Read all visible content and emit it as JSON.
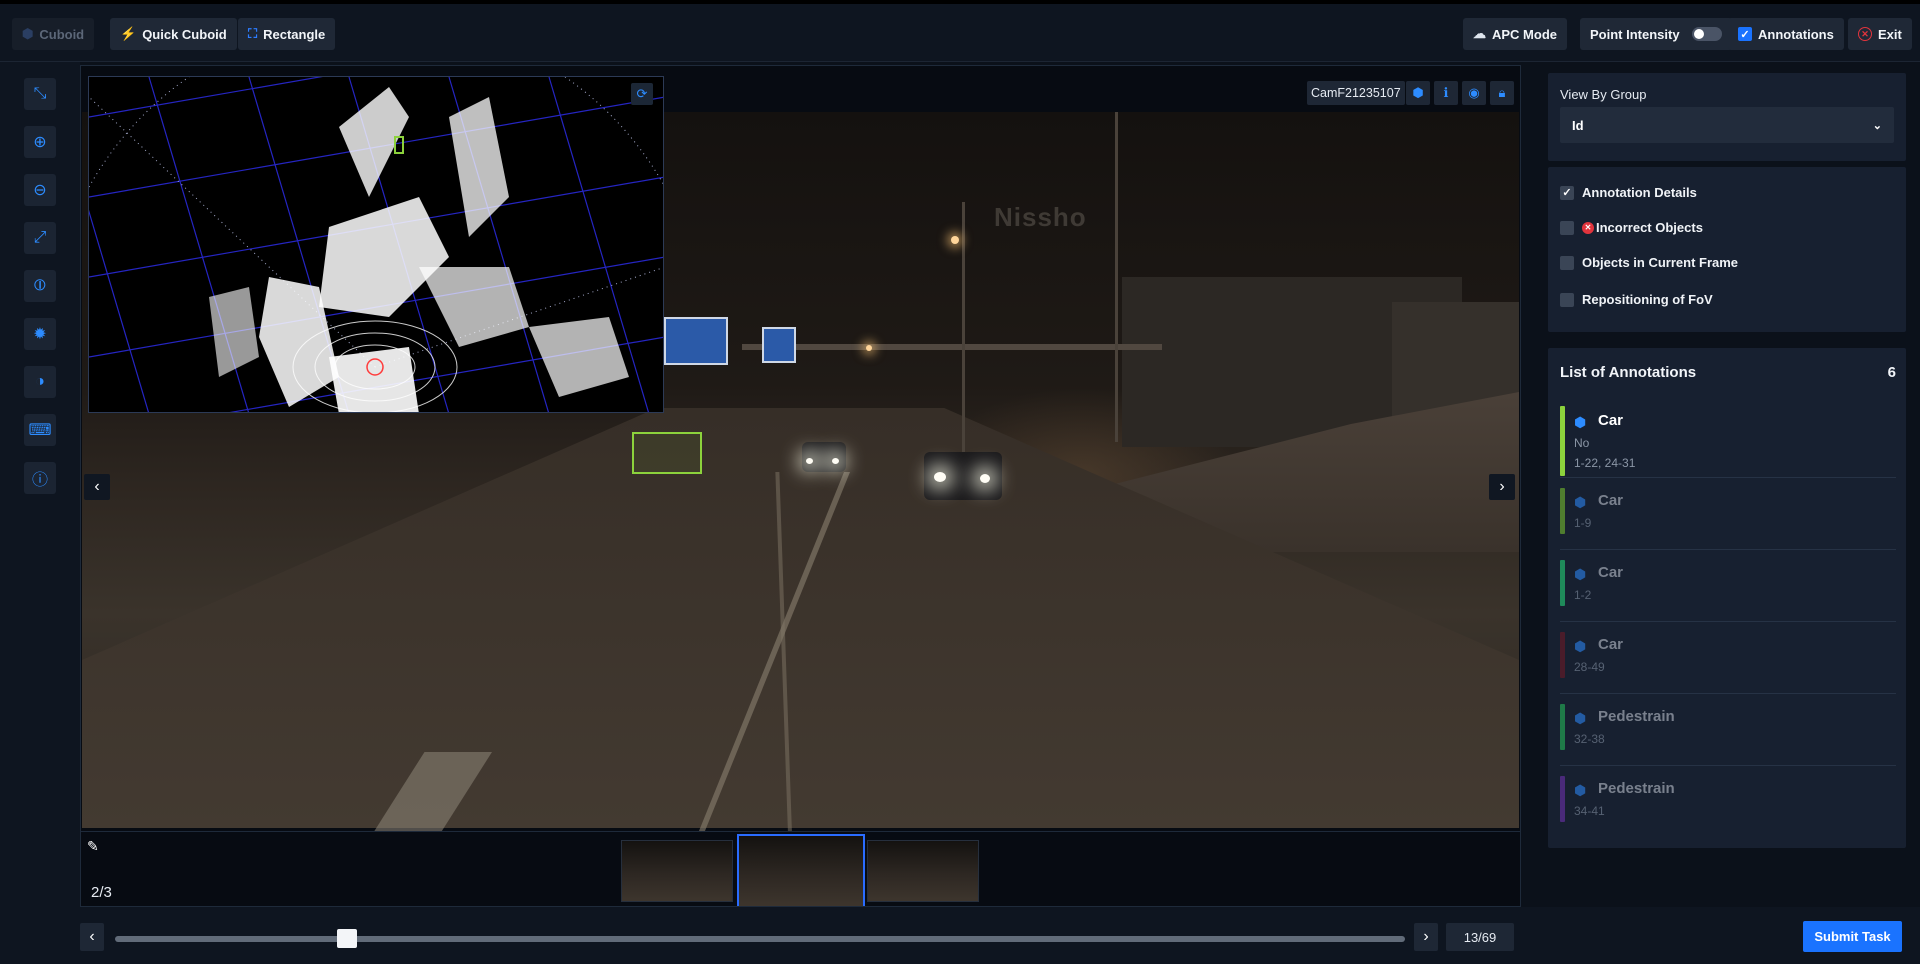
{
  "toolbar": {
    "cuboid": "Cuboid",
    "quick_cuboid": "Quick Cuboid",
    "rectangle": "Rectangle",
    "apc_mode": "APC Mode",
    "point_intensity": "Point Intensity",
    "annotations": "Annotations",
    "exit": "Exit"
  },
  "left_tools": [
    "compress-icon",
    "zoom-in-icon",
    "zoom-out-icon",
    "fit-screen-icon",
    "crosshair-icon",
    "brightness-icon",
    "contrast-icon",
    "keyboard-icon",
    "info-icon"
  ],
  "viewer": {
    "camera": "CamF21235107",
    "scene_sign": "Nissho",
    "frame_counter": "2/3"
  },
  "timeline": {
    "frame_label": "13/69",
    "progress": 0.18
  },
  "submit": "Submit Task",
  "group_panel": {
    "label": "View By Group",
    "selected": "Id"
  },
  "options": [
    {
      "label": "Annotation Details",
      "checked": true
    },
    {
      "label": "Incorrect Objects",
      "checked": false
    },
    {
      "label": "Objects in Current Frame",
      "checked": false
    },
    {
      "label": "Repositioning of FoV",
      "checked": false
    }
  ],
  "annotation_list": {
    "title": "List of Annotations",
    "count": "6",
    "items": [
      {
        "name": "Car",
        "sub": "No",
        "range": "1-22, 24-31",
        "color": "#8cd23c"
      },
      {
        "name": "Car",
        "sub": "",
        "range": "1-9",
        "color": "#4f7d2f"
      },
      {
        "name": "Car",
        "sub": "",
        "range": "1-2",
        "color": "#1f8a5a"
      },
      {
        "name": "Car",
        "sub": "",
        "range": "28-49",
        "color": "#4a1c2a"
      },
      {
        "name": "Pedestrain",
        "sub": "",
        "range": "32-38",
        "color": "#1f7a48"
      },
      {
        "name": "Pedestrain",
        "sub": "",
        "range": "34-41",
        "color": "#4a2a7a"
      }
    ]
  },
  "colors": {
    "accent": "#1a73ff",
    "panel": "#172030",
    "background": "#0b111a"
  }
}
